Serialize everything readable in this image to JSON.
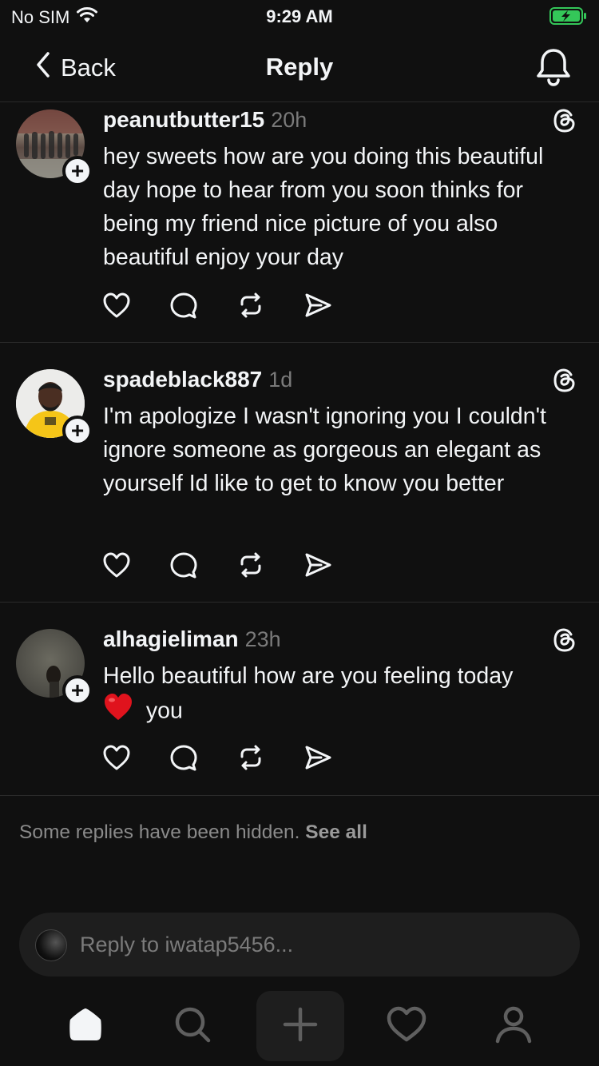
{
  "status_bar": {
    "carrier": "No SIM",
    "time": "9:29 AM"
  },
  "nav": {
    "back_label": "Back",
    "title": "Reply"
  },
  "posts": [
    {
      "username": "peanutbutter15",
      "age": "20h",
      "text": "hey sweets how are you doing this beautiful day hope to hear from you soon thinks for being my friend nice picture of you also beautiful enjoy your day"
    },
    {
      "username": "spadeblack887",
      "age": "1d",
      "text": "I'm apologize I wasn't ignoring you I couldn't ignore someone as gorgeous an elegant as yourself Id like to get to know you better"
    },
    {
      "username": "alhagieliman",
      "age": "23h",
      "text_before_emoji": "Hello beautiful how are you feeling today",
      "emoji": "❤️",
      "text_after_emoji": "you"
    }
  ],
  "hidden_note": {
    "text": "Some replies have been hidden.",
    "link": "See all"
  },
  "reply_bar": {
    "placeholder": "Reply to iwatap5456..."
  },
  "tabbar": {
    "items": [
      "home-icon",
      "search-icon",
      "compose-icon",
      "activity-icon",
      "profile-icon"
    ]
  },
  "colors": {
    "background": "#101010",
    "text": "#f3f5f7",
    "muted": "#7a7a7a",
    "battery_green": "#34c759"
  }
}
